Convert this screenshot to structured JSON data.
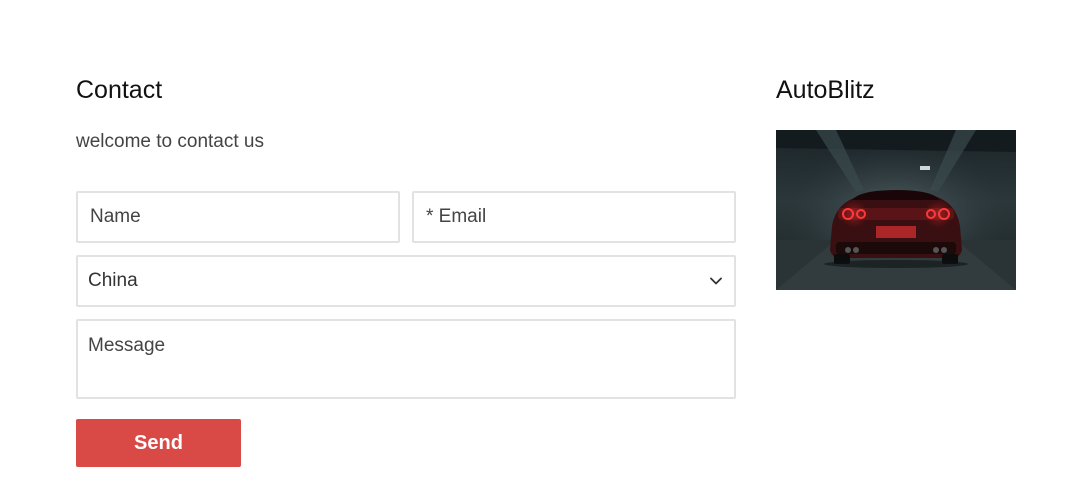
{
  "contact": {
    "title": "Contact",
    "subtitle": "welcome to contact us",
    "name_placeholder": "Name",
    "email_placeholder": "* Email",
    "country_value": "China",
    "message_placeholder": "Message",
    "send_label": "Send"
  },
  "brand": {
    "title": "AutoBlitz"
  },
  "colors": {
    "accent": "#d94a47",
    "border": "#e2e2e2"
  },
  "icons": {
    "select": "chevron-down-icon"
  }
}
